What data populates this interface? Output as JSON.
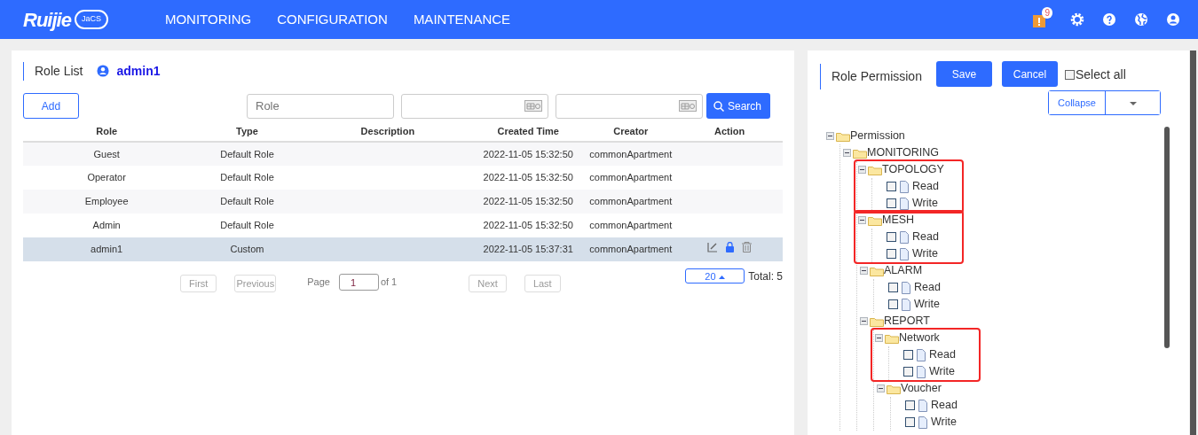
{
  "navbar": {
    "logo_text": "Ruijie",
    "logo_badge": "JaCS",
    "menu": [
      {
        "label": "MONITORING"
      },
      {
        "label": "CONFIGURATION"
      },
      {
        "label": "MAINTENANCE"
      }
    ],
    "alert_count": "9"
  },
  "role_list": {
    "title": "Role List",
    "current_user": "admin1",
    "add_button": "Add",
    "role_filter": {
      "placeholder": "Role"
    },
    "search_button": "Search",
    "columns": [
      "Role",
      "Type",
      "Description",
      "Created Time",
      "Creator",
      "Action"
    ],
    "rows": [
      {
        "role": "Guest",
        "type": "Default Role",
        "description": "",
        "created": "2022-11-05 15:32:50",
        "creator": "commonApartment",
        "selected": false,
        "editable": false
      },
      {
        "role": "Operator",
        "type": "Default Role",
        "description": "",
        "created": "2022-11-05 15:32:50",
        "creator": "commonApartment",
        "selected": false,
        "editable": false
      },
      {
        "role": "Employee",
        "type": "Default Role",
        "description": "",
        "created": "2022-11-05 15:32:50",
        "creator": "commonApartment",
        "selected": false,
        "editable": false
      },
      {
        "role": "Admin",
        "type": "Default Role",
        "description": "",
        "created": "2022-11-05 15:32:50",
        "creator": "commonApartment",
        "selected": false,
        "editable": false
      },
      {
        "role": "admin1",
        "type": "Custom",
        "description": "",
        "created": "2022-11-05 15:37:31",
        "creator": "commonApartment",
        "selected": true,
        "editable": true
      }
    ],
    "pagination": {
      "first": "First",
      "previous": "Previous",
      "page_label": "Page",
      "page": "1",
      "of": "of 1",
      "next": "Next",
      "last": "Last",
      "page_size": "20",
      "total": "Total: 5"
    }
  },
  "role_permission": {
    "title": "Role Permission",
    "save": "Save",
    "cancel": "Cancel",
    "select_all": {
      "label": "Select all",
      "checked": false
    },
    "collapse": "Collapse",
    "tree": [
      {
        "label": "Permission",
        "expanded": true,
        "highlighted": false,
        "children": [
          {
            "label": "MONITORING",
            "expanded": true,
            "highlighted": false,
            "children": [
              {
                "label": "TOPOLOGY",
                "expanded": true,
                "highlighted": true,
                "children": [
                  {
                    "label": "Read",
                    "checked": false
                  },
                  {
                    "label": "Write",
                    "checked": false
                  }
                ]
              },
              {
                "label": "MESH",
                "expanded": true,
                "highlighted": true,
                "children": [
                  {
                    "label": "Read",
                    "checked": false
                  },
                  {
                    "label": "Write",
                    "checked": false
                  }
                ]
              },
              {
                "label": "ALARM",
                "expanded": true,
                "highlighted": false,
                "children": [
                  {
                    "label": "Read",
                    "checked": false
                  },
                  {
                    "label": "Write",
                    "checked": false
                  }
                ]
              },
              {
                "label": "REPORT",
                "expanded": true,
                "highlighted": false,
                "children": [
                  {
                    "label": "Network",
                    "expanded": true,
                    "highlighted": true,
                    "children": [
                      {
                        "label": "Read",
                        "checked": false
                      },
                      {
                        "label": "Write",
                        "checked": false
                      }
                    ]
                  },
                  {
                    "label": "Voucher",
                    "expanded": true,
                    "highlighted": false,
                    "children": [
                      {
                        "label": "Read",
                        "checked": false
                      },
                      {
                        "label": "Write",
                        "checked": false
                      }
                    ]
                  }
                ]
              }
            ]
          }
        ]
      }
    ]
  }
}
